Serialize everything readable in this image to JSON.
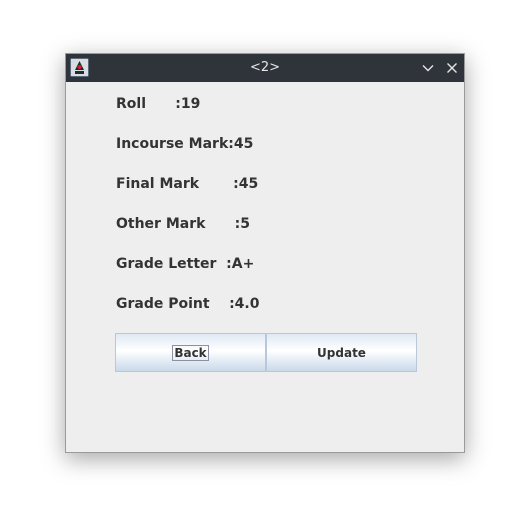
{
  "window": {
    "title": "<2>",
    "app_icon": "java-duke-icon",
    "controls": {
      "minimize_icon": "chevron-down-icon",
      "close_icon": "close-icon"
    }
  },
  "fields": {
    "roll": "Roll      :19",
    "incourse_mark": "Incourse Mark:45",
    "final_mark": "Final Mark       :45",
    "other_mark": "Other Mark      :5",
    "grade_letter": "Grade Letter  :A+",
    "grade_point": "Grade Point    :4.0"
  },
  "buttons": {
    "back": "Back",
    "update": "Update"
  },
  "colors": {
    "titlebar": "#2f343a",
    "window_bg": "#eeeeee",
    "text": "#333333",
    "button_gradient_top": "#dfe9f4",
    "button_gradient_bottom": "#c9d9ea"
  }
}
